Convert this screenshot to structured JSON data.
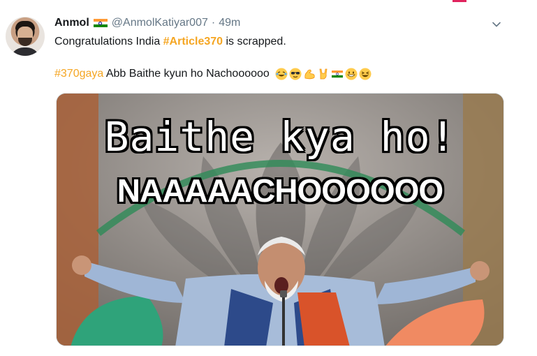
{
  "tweet": {
    "author_name": "Anmol",
    "handle": "@AnmolKatiyar007",
    "separator": "·",
    "time": "49m",
    "line1_prefix": "Congratulations India ",
    "line1_hashtag": "#Article370",
    "line1_suffix": " is scrapped.",
    "line2_hashtag": "#370gaya",
    "line2_text": " Abb Baithe kyun ho Nachoooooo",
    "emojis": [
      "joy-emoji",
      "sunglasses-emoji",
      "flexed-biceps-emoji",
      "rock-on-emoji",
      "india-flag-emoji",
      "grin-emoji",
      "laughing-emoji"
    ]
  },
  "media": {
    "caption_top": "Baithe kya ho!",
    "caption_bottom": "NAAAAACHOOOOOO"
  },
  "colors": {
    "hashtag": "#f5a623",
    "secondary_text": "#657786",
    "accent": "#e0245e"
  }
}
